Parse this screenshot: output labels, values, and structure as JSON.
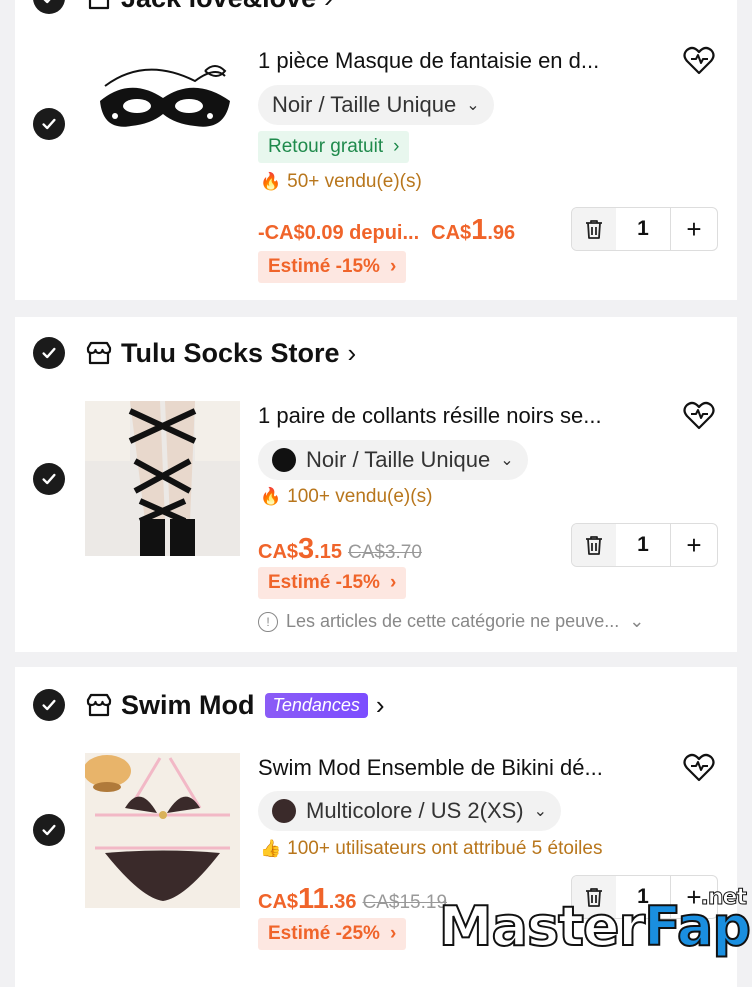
{
  "stores": [
    {
      "name": "Jack love&love",
      "badge": "",
      "item": {
        "title": "1 pièce Masque de fantaisie en d...",
        "variant": "Noir / Taille Unique",
        "free_return": "Retour gratuit",
        "sold": "50+ vendu(e)(s)",
        "price_drop": "-CA$0.09 depui...",
        "currency": "CA$",
        "price_int": "1",
        "price_dec": ".96",
        "old_price": "",
        "estimate": "Estimé -15%",
        "quantity": "1",
        "notice": ""
      }
    },
    {
      "name": "Tulu Socks Store",
      "badge": "",
      "item": {
        "title": "1 paire de collants résille noirs se...",
        "variant": "Noir / Taille Unique",
        "swatch_color": "#111111",
        "free_return": "",
        "sold": "100+ vendu(e)(s)",
        "price_drop": "",
        "currency": "CA$",
        "price_int": "3",
        "price_dec": ".15",
        "old_price": "CA$3.70",
        "estimate": "Estimé -15%",
        "quantity": "1",
        "notice": "Les articles de cette catégorie ne peuve..."
      }
    },
    {
      "name": "Swim Mod",
      "badge": "Tendances",
      "item": {
        "title": "Swim Mod Ensemble de Bikini dé...",
        "variant": "Multicolore / US 2(XS)",
        "swatch_color": "#3a2a2a",
        "free_return": "",
        "sold": "100+ utilisateurs ont attribué 5 étoiles",
        "price_drop": "",
        "currency": "CA$",
        "price_int": "11",
        "price_dec": ".36",
        "old_price": "CA$15.19",
        "estimate": "Estimé -25%",
        "quantity": "1",
        "notice": ""
      }
    }
  ],
  "icons": {
    "check": "check-icon",
    "store": "store-icon",
    "wishlist": "heart-plus-icon",
    "delete": "trash-icon",
    "plus": "plus-icon",
    "chevron": "chevron-icon",
    "fire": "fire-icon",
    "thumbs_up": "thumbs-up-icon",
    "info": "info-icon"
  },
  "colors": {
    "price": "#f0642a",
    "free_return_bg": "#e8f7ee",
    "free_return_text": "#1f8a4c",
    "sold_text": "#b8761c",
    "badge": "#8b5cf6"
  },
  "watermark": {
    "part1": "Master",
    "part2": "Fap",
    "suffix": ".net"
  }
}
